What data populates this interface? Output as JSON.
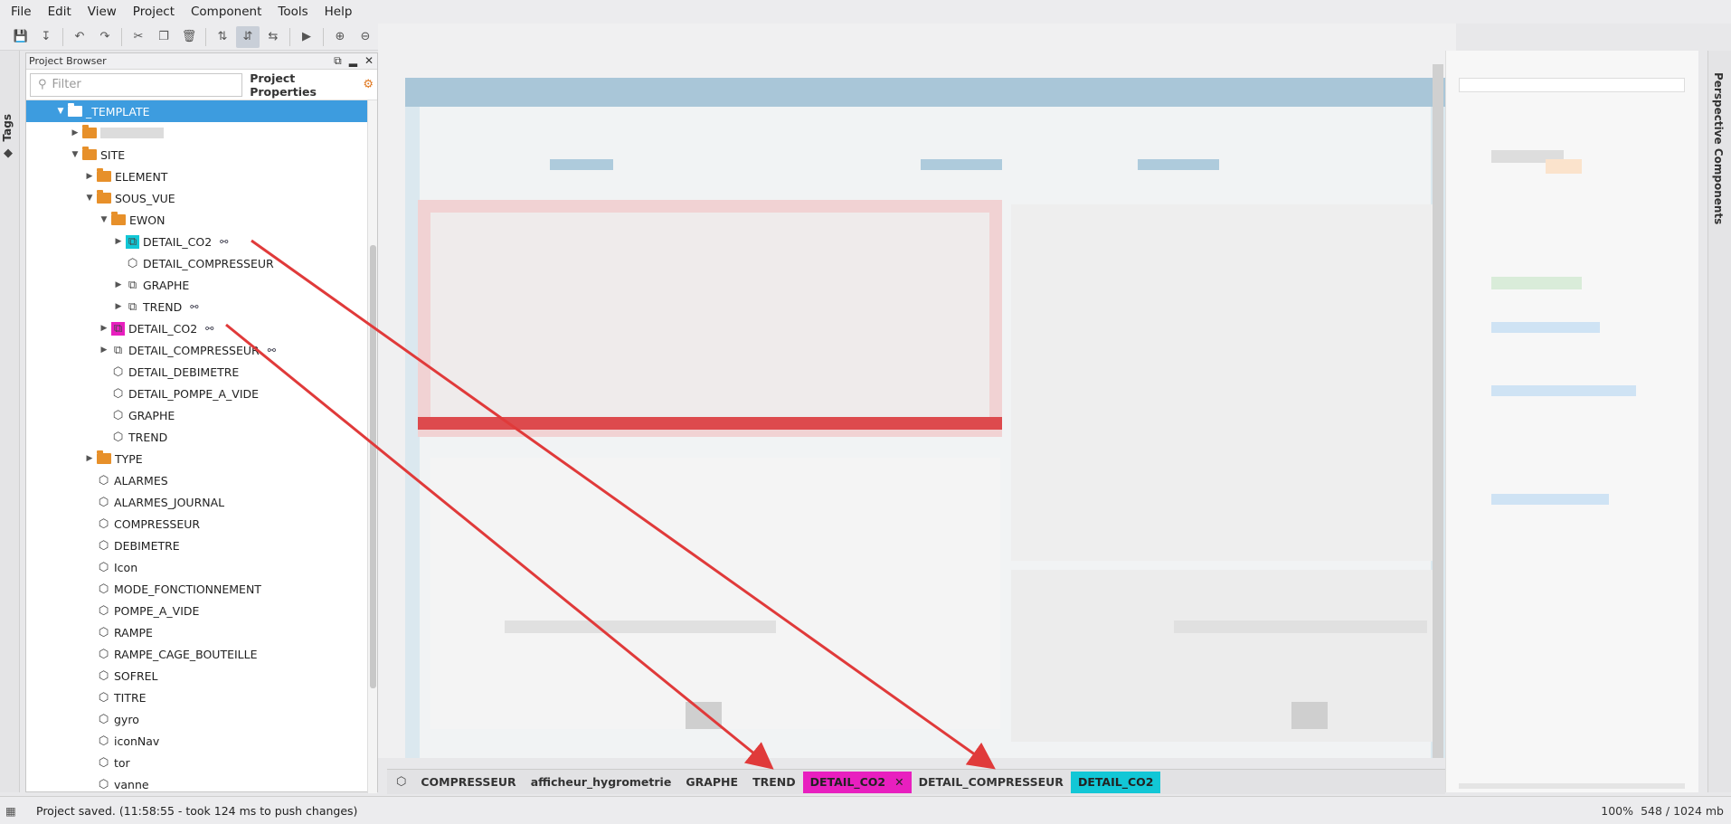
{
  "menu": [
    "File",
    "Edit",
    "View",
    "Project",
    "Component",
    "Tools",
    "Help"
  ],
  "sidebar_left": {
    "tags_label": "Tags"
  },
  "project_browser": {
    "title": "Project Browser",
    "filter_placeholder": "Filter",
    "properties_label": "Project Properties",
    "tree": [
      {
        "label": "_TEMPLATE",
        "kind": "folder",
        "level": 3,
        "state": "open",
        "selected": true
      },
      {
        "label": "",
        "kind": "folder",
        "level": 4,
        "state": "closed"
      },
      {
        "label": "SITE",
        "kind": "folder",
        "level": 4,
        "state": "open"
      },
      {
        "label": "ELEMENT",
        "kind": "folder",
        "level": 5,
        "state": "closed"
      },
      {
        "label": "SOUS_VUE",
        "kind": "folder",
        "level": 5,
        "state": "open"
      },
      {
        "label": "EWON",
        "kind": "folder",
        "level": 6,
        "state": "open"
      },
      {
        "label": "DETAIL_CO2",
        "kind": "view-edited",
        "level": 7,
        "state": "closed",
        "highlight": "cyan",
        "linked": true
      },
      {
        "label": "DETAIL_COMPRESSEUR",
        "kind": "view",
        "level": 7,
        "state": "none"
      },
      {
        "label": "GRAPHE",
        "kind": "view-edited",
        "level": 7,
        "state": "closed"
      },
      {
        "label": "TREND",
        "kind": "view-edited",
        "level": 7,
        "state": "closed",
        "linked": true
      },
      {
        "label": "DETAIL_CO2",
        "kind": "view-edited",
        "level": 6,
        "state": "closed",
        "highlight": "magenta",
        "linked": true
      },
      {
        "label": "DETAIL_COMPRESSEUR",
        "kind": "view-edited",
        "level": 6,
        "state": "closed",
        "linked": true
      },
      {
        "label": "DETAIL_DEBIMETRE",
        "kind": "view",
        "level": 6,
        "state": "none"
      },
      {
        "label": "DETAIL_POMPE_A_VIDE",
        "kind": "view",
        "level": 6,
        "state": "none"
      },
      {
        "label": "GRAPHE",
        "kind": "view",
        "level": 6,
        "state": "none"
      },
      {
        "label": "TREND",
        "kind": "view",
        "level": 6,
        "state": "none"
      },
      {
        "label": "TYPE",
        "kind": "folder",
        "level": 5,
        "state": "closed"
      },
      {
        "label": "ALARMES",
        "kind": "view",
        "level": 5,
        "state": "none"
      },
      {
        "label": "ALARMES_JOURNAL",
        "kind": "view",
        "level": 5,
        "state": "none"
      },
      {
        "label": "COMPRESSEUR",
        "kind": "view",
        "level": 5,
        "state": "none"
      },
      {
        "label": "DEBIMETRE",
        "kind": "view",
        "level": 5,
        "state": "none"
      },
      {
        "label": "Icon",
        "kind": "view",
        "level": 5,
        "state": "none"
      },
      {
        "label": "MODE_FONCTIONNEMENT",
        "kind": "view",
        "level": 5,
        "state": "none"
      },
      {
        "label": "POMPE_A_VIDE",
        "kind": "view",
        "level": 5,
        "state": "none"
      },
      {
        "label": "RAMPE",
        "kind": "view",
        "level": 5,
        "state": "none"
      },
      {
        "label": "RAMPE_CAGE_BOUTEILLE",
        "kind": "view",
        "level": 5,
        "state": "none"
      },
      {
        "label": "SOFREL",
        "kind": "view",
        "level": 5,
        "state": "none"
      },
      {
        "label": "TITRE",
        "kind": "view",
        "level": 5,
        "state": "none"
      },
      {
        "label": "gyro",
        "kind": "view",
        "level": 5,
        "state": "none"
      },
      {
        "label": "iconNav",
        "kind": "view",
        "level": 5,
        "state": "none"
      },
      {
        "label": "tor",
        "kind": "view",
        "level": 5,
        "state": "none"
      },
      {
        "label": "vanne",
        "kind": "view",
        "level": 5,
        "state": "none"
      }
    ]
  },
  "sidebar_right": {
    "components_label": "Perspective Components"
  },
  "tabs": [
    {
      "label": "COMPRESSEUR"
    },
    {
      "label": "afficheur_hygrometrie"
    },
    {
      "label": "GRAPHE"
    },
    {
      "label": "TREND"
    },
    {
      "label": "DETAIL_CO2",
      "highlight": "magenta",
      "closable": true
    },
    {
      "label": "DETAIL_COMPRESSEUR"
    },
    {
      "label": "DETAIL_CO2",
      "highlight": "cyan"
    }
  ],
  "status": {
    "message": "Project saved. (11:58:55 - took 124 ms to push changes)",
    "zoom": "100%",
    "memory": "548 / 1024 mb"
  },
  "colors": {
    "selection": "#3d9cdf",
    "highlight_cyan": "#12c7d6",
    "highlight_magenta": "#e81fbf",
    "annotation_arrow": "#e03a3a"
  }
}
